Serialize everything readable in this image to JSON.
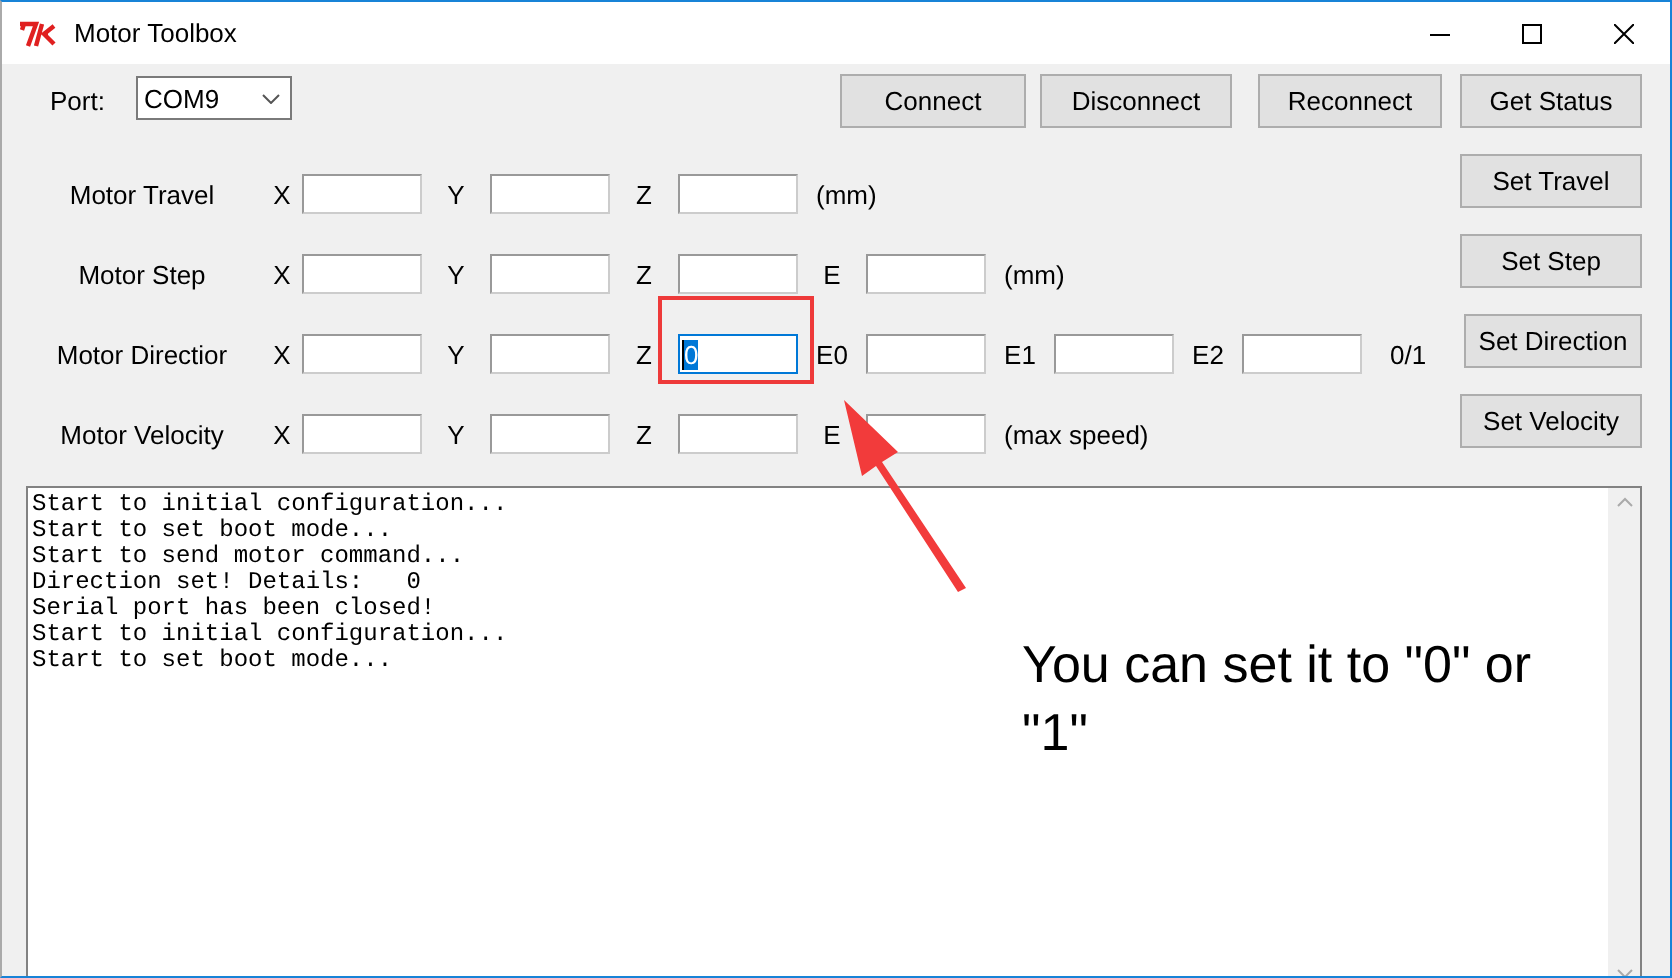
{
  "window": {
    "title": "Motor Toolbox"
  },
  "port": {
    "label": "Port:",
    "value": "COM9"
  },
  "top_buttons": [
    "Connect",
    "Disconnect",
    "Reconnect",
    "Get Status"
  ],
  "rows": [
    {
      "label": "Motor Travel",
      "fields": [
        {
          "axis": "X",
          "selected": false
        },
        {
          "axis": "Y",
          "selected": false
        },
        {
          "axis": "Z",
          "selected": false
        }
      ],
      "unit": "(mm)",
      "button": "Set Travel"
    },
    {
      "label": "Motor Step",
      "fields": [
        {
          "axis": "X",
          "selected": false
        },
        {
          "axis": "Y",
          "selected": false
        },
        {
          "axis": "Z",
          "selected": false
        },
        {
          "axis": "E",
          "selected": false
        }
      ],
      "unit": "(mm)",
      "button": "Set Step"
    },
    {
      "label": "Motor Directior",
      "fields": [
        {
          "axis": "X",
          "selected": false
        },
        {
          "axis": "Y",
          "selected": false
        },
        {
          "axis": "Z",
          "value": "0",
          "selected": true
        },
        {
          "axis": "E0",
          "selected": false
        },
        {
          "axis": "E1",
          "selected": false
        },
        {
          "axis": "E2",
          "selected": false
        }
      ],
      "unit": "0/1",
      "button": "Set Direction"
    },
    {
      "label": "Motor Velocity",
      "fields": [
        {
          "axis": "X",
          "selected": false
        },
        {
          "axis": "Y",
          "selected": false
        },
        {
          "axis": "Z",
          "selected": false
        },
        {
          "axis": "E",
          "selected": false
        }
      ],
      "unit": "(max speed)",
      "button": "Set Velocity"
    }
  ],
  "log": [
    "Start to initial configuration...",
    "Start to set boot mode...",
    "Start to send motor command...",
    "Direction set! Details:   0",
    "Serial port has been closed!",
    "Start to initial configuration...",
    "Start to set boot mode..."
  ],
  "annotation": {
    "caption": "You can set it to \"0\" or \"1\""
  }
}
